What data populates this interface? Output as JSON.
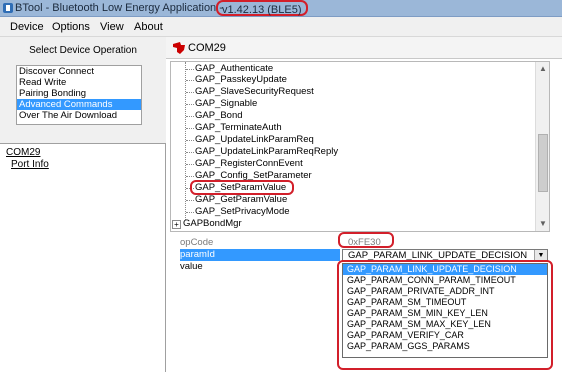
{
  "window": {
    "title": "BTool - Bluetooth Low Energy Application - ",
    "version": "v1.42.13 (BLE5)"
  },
  "menu": [
    "Device",
    "Options",
    "View",
    "About"
  ],
  "left": {
    "select_op_label": "Select Device Operation",
    "operations": [
      {
        "label": "Discover Connect",
        "selected": false
      },
      {
        "label": "Read Write",
        "selected": false
      },
      {
        "label": "Pairing Bonding",
        "selected": false
      },
      {
        "label": "Advanced Commands",
        "selected": true
      },
      {
        "label": "Over The Air Download",
        "selected": false
      }
    ],
    "device": "COM29",
    "port_info": "Port Info"
  },
  "right": {
    "tab_title": "COM29",
    "commands": [
      "GAP_Authenticate",
      "GAP_PasskeyUpdate",
      "GAP_SlaveSecurityRequest",
      "GAP_Signable",
      "GAP_Bond",
      "GAP_TerminateAuth",
      "GAP_UpdateLinkParamReq",
      "GAP_UpdateLinkParamReqReply",
      "GAP_RegisterConnEvent",
      "GAP_Config_SetParameter",
      "GAP_SetParamValue",
      "GAP_GetParamValue",
      "GAP_SetPrivacyMode"
    ],
    "group_collapsed": "GAPBondMgr",
    "highlighted_command": "GAP_SetParamValue"
  },
  "params": {
    "opcode_label": "opCode",
    "opcode_value": "0xFE30",
    "paramid_label": "paramId",
    "paramid_value": "GAP_PARAM_LINK_UPDATE_DECISION",
    "value_label": "value"
  },
  "dropdown_options": [
    {
      "label": "GAP_PARAM_LINK_UPDATE_DECISION",
      "selected": true
    },
    {
      "label": "GAP_PARAM_CONN_PARAM_TIMEOUT",
      "selected": false
    },
    {
      "label": "GAP_PARAM_PRIVATE_ADDR_INT",
      "selected": false
    },
    {
      "label": "GAP_PARAM_SM_TIMEOUT",
      "selected": false
    },
    {
      "label": "GAP_PARAM_SM_MIN_KEY_LEN",
      "selected": false
    },
    {
      "label": "GAP_PARAM_SM_MAX_KEY_LEN",
      "selected": false
    },
    {
      "label": "GAP_PARAM_VERIFY_CAR",
      "selected": false
    },
    {
      "label": "GAP_PARAM_GGS_PARAMS",
      "selected": false
    }
  ],
  "colors": {
    "highlight_red": "#d21f2a",
    "selection_blue": "#3399ff",
    "ti_red": "#cc0000"
  },
  "icons": {
    "app": "app-icon",
    "ti_logo": "ti-logo-icon",
    "scroll_up": "scroll-up-icon",
    "scroll_down": "scroll-down-icon",
    "dropdown_arrow": "chevron-down-icon",
    "expander_plus": "expand-plus-icon"
  }
}
